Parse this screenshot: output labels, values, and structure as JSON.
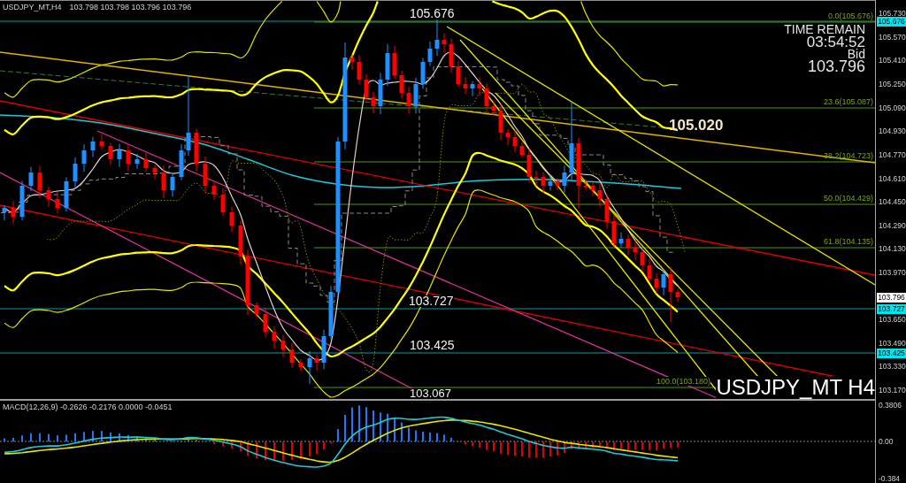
{
  "chart_header": {
    "symbol": "USDJPY_MT,H4",
    "quote": "103.798 103.798 103.796 103.796"
  },
  "level_labels": [
    "105.676",
    "103.727",
    "103.425",
    "103.067"
  ],
  "timer": {
    "label": "TIME REMAIN",
    "countdown": "03:54:52",
    "price_type": "Bid",
    "price": "103.796"
  },
  "trendline_label": "105.020",
  "fibonacci_labels": [
    "0.0(105.676)",
    "23.6(105.087)",
    "38.2(104.723)",
    "50.0(104.429)",
    "61.8(104.135)",
    "100.0(103.180)"
  ],
  "symbol_label": "USDJPY_MT H4",
  "price_axis": {
    "ticks": [
      "105.730",
      "105.570",
      "105.410",
      "105.250",
      "105.090",
      "104.930",
      "104.770",
      "104.610",
      "104.450",
      "104.290",
      "104.130",
      "103.970",
      "103.650",
      "103.490",
      "103.330",
      "103.170"
    ],
    "markers": [
      {
        "label": "105.676",
        "kind": "line"
      },
      {
        "label": "103.796",
        "kind": "bid"
      },
      {
        "label": "103.727",
        "kind": "line"
      },
      {
        "label": "103.425",
        "kind": "line"
      }
    ]
  },
  "macd": {
    "header": "MACD(12,26,9) -0.2626 -0.2176 0.0000 -0.0451",
    "ticks": [
      "0.3806",
      "0.00",
      "-0.384"
    ]
  }
}
